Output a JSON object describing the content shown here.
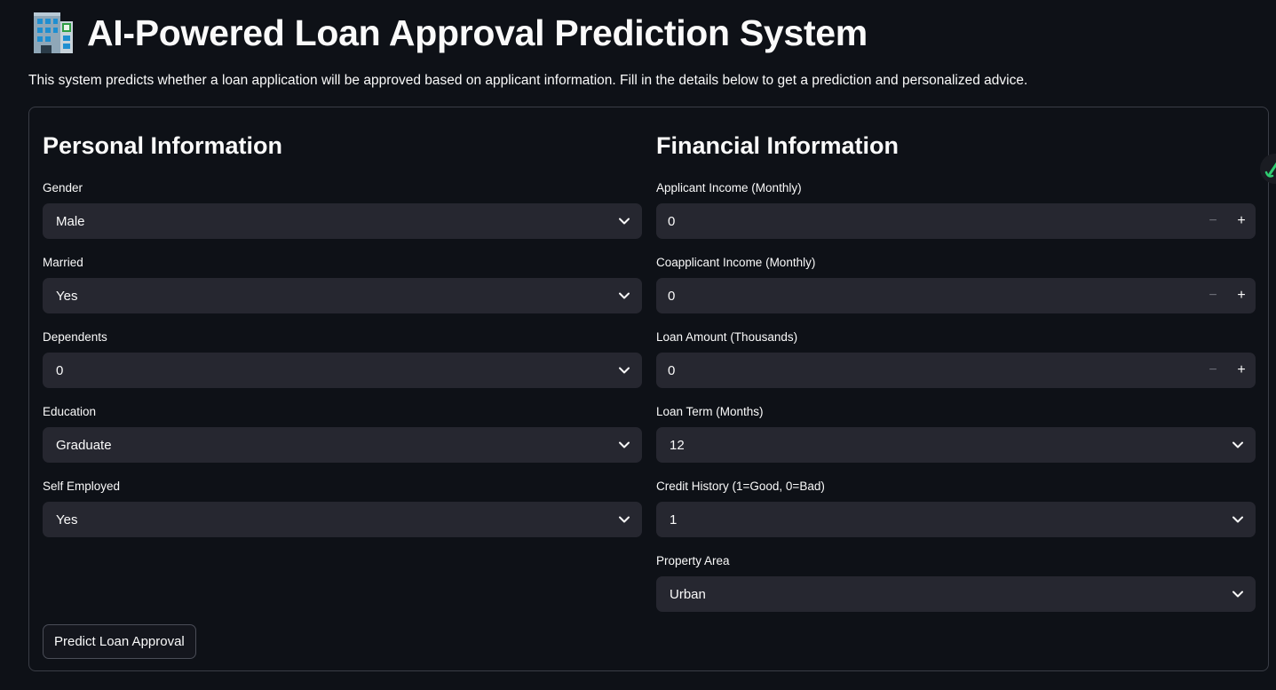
{
  "header": {
    "title": "AI-Powered Loan Approval Prediction System",
    "title_icon": "office-building-icon",
    "description": "This system predicts whether a loan application will be approved based on applicant information. Fill in the details below to get a prediction and personalized advice."
  },
  "personal": {
    "heading": "Personal Information",
    "fields": [
      {
        "label": "Gender",
        "value": "Male"
      },
      {
        "label": "Married",
        "value": "Yes"
      },
      {
        "label": "Dependents",
        "value": "0"
      },
      {
        "label": "Education",
        "value": "Graduate"
      },
      {
        "label": "Self Employed",
        "value": "Yes"
      }
    ]
  },
  "financial": {
    "heading": "Financial Information",
    "fields": [
      {
        "label": "Applicant Income (Monthly)",
        "value": "0",
        "type": "number"
      },
      {
        "label": "Coapplicant Income (Monthly)",
        "value": "0",
        "type": "number"
      },
      {
        "label": "Loan Amount (Thousands)",
        "value": "0",
        "type": "number"
      },
      {
        "label": "Loan Term (Months)",
        "value": "12",
        "type": "select"
      },
      {
        "label": "Credit History (1=Good, 0=Bad)",
        "value": "1",
        "type": "select"
      },
      {
        "label": "Property Area",
        "value": "Urban",
        "type": "select"
      }
    ]
  },
  "actions": {
    "predict_label": "Predict Loan Approval"
  },
  "stepper": {
    "minus": "−",
    "plus": "+"
  },
  "colors": {
    "background": "#0e1117",
    "input_background": "#262730",
    "text": "#fafafa",
    "border": "#3a3d46"
  }
}
